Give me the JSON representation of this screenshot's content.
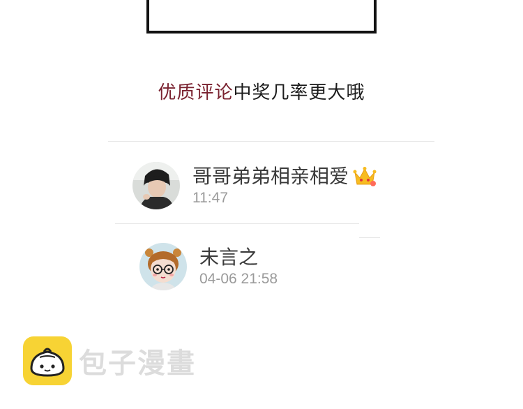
{
  "promo": {
    "accent_text": "优质评论",
    "rest_text": "中奖几率更大哦"
  },
  "comments": [
    {
      "username": "哥哥弟弟相亲相爱",
      "badge_icon": "crown-icon",
      "time": "11:47"
    },
    {
      "username": "未言之",
      "time": "04-06 21:58"
    }
  ],
  "watermark": {
    "text": "包子漫畫",
    "icon": "bun-logo-icon",
    "logo_color": "#f7d334"
  },
  "colors": {
    "promo_accent": "#7a2230",
    "username": "#3b3b3b",
    "time": "#9a9a9a"
  }
}
